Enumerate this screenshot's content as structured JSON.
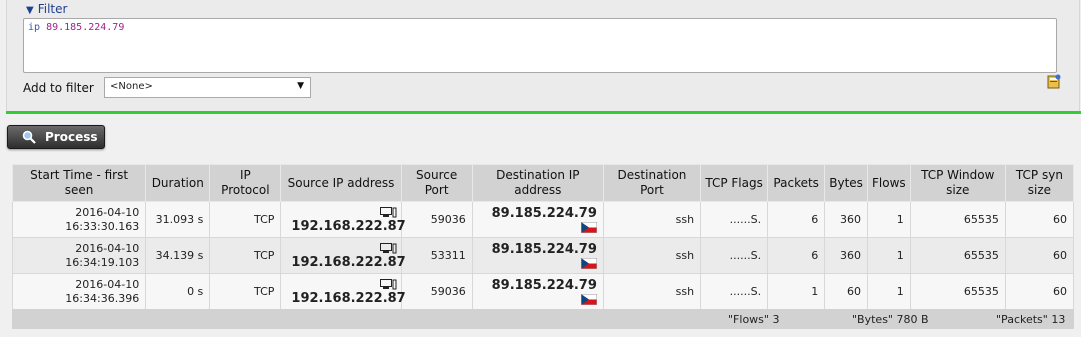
{
  "filter": {
    "toggle_label": "Filter",
    "expression_keyword": "ip",
    "expression_value": "89.185.224.79",
    "add_to_filter_label": "Add to filter",
    "add_to_filter_selected": "<None>"
  },
  "process_button": {
    "label": "Process"
  },
  "table": {
    "headers": [
      "Start Time - first seen",
      "Duration",
      "IP Protocol",
      "Source IP address",
      "Source Port",
      "Destination IP address",
      "Destination Port",
      "TCP Flags",
      "Packets",
      "Bytes",
      "Flows",
      "TCP Window size",
      "TCP syn size"
    ],
    "rows": [
      {
        "date": "2016-04-10",
        "time": "16:33:30.163",
        "duration": "31.093 s",
        "protocol": "TCP",
        "src_ip": "192.168.222.87",
        "src_port": "59036",
        "dst_ip": "89.185.224.79",
        "dst_port": "ssh",
        "flags": "......S.",
        "packets": "6",
        "bytes": "360",
        "flows": "1",
        "window": "65535",
        "syn": "60"
      },
      {
        "date": "2016-04-10",
        "time": "16:34:19.103",
        "duration": "34.139 s",
        "protocol": "TCP",
        "src_ip": "192.168.222.87",
        "src_port": "53311",
        "dst_ip": "89.185.224.79",
        "dst_port": "ssh",
        "flags": "......S.",
        "packets": "6",
        "bytes": "360",
        "flows": "1",
        "window": "65535",
        "syn": "60"
      },
      {
        "date": "2016-04-10",
        "time": "16:34:36.396",
        "duration": "0 s",
        "protocol": "TCP",
        "src_ip": "192.168.222.87",
        "src_port": "59036",
        "dst_ip": "89.185.224.79",
        "dst_port": "ssh",
        "flags": "......S.",
        "packets": "1",
        "bytes": "60",
        "flows": "1",
        "window": "65535",
        "syn": "60"
      }
    ]
  },
  "summary": {
    "flows": "\"Flows\" 3",
    "bytes": "\"Bytes\" 780 B",
    "packets": "\"Packets\" 13"
  },
  "icons": {
    "filter_toggle": "triangle-down-icon",
    "help": "help-book-icon",
    "process": "magnifier-icon",
    "source": "computer-device-icon",
    "destination": "czech-flag-icon"
  },
  "colors": {
    "accent_green": "#33cc33",
    "link_blue": "#1f3f8f",
    "filter_value": "#a0208f"
  }
}
